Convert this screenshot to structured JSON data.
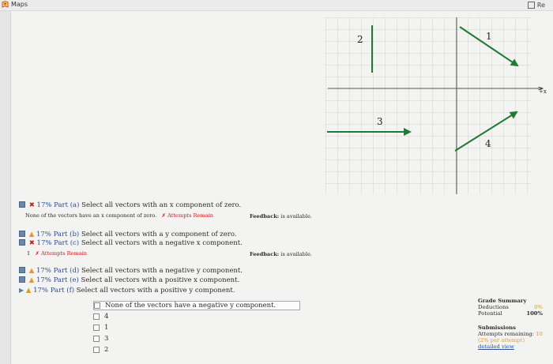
{
  "app": {
    "title": "Maps",
    "top_right_label": "Re"
  },
  "graph": {
    "axis_label": "+x",
    "vectors": [
      {
        "label": "1",
        "color": "#1f7a33"
      },
      {
        "label": "2",
        "color": "#1f7a33"
      },
      {
        "label": "3",
        "color": "#1f7a33"
      },
      {
        "label": "4",
        "color": "#1f7a33"
      }
    ]
  },
  "parts": {
    "a": {
      "pct": "17%",
      "part": "Part (a)",
      "text": "Select all vectors with an x component of zero.",
      "answer": "None of the vectors have an x component of zero.",
      "attempts": "✗ Attempts Remain",
      "feedback_label": "Feedback:",
      "feedback_text": "is available."
    },
    "b": {
      "pct": "17%",
      "part": "Part (b)",
      "text": "Select all vectors with a y component of zero."
    },
    "c": {
      "pct": "17%",
      "part": "Part (c)",
      "text": "Select all vectors with a negative x component.",
      "attempts_prefix": "1",
      "attempts": "✗ Attempts Remain",
      "feedback_label": "Feedback:",
      "feedback_text": "is available."
    },
    "d": {
      "pct": "17%",
      "part": "Part (d)",
      "text": "Select all vectors with a negative y component."
    },
    "e": {
      "pct": "17%",
      "part": "Part (e)",
      "text": "Select all vectors with a positive x component."
    },
    "f": {
      "pct": "17%",
      "part": "Part (f)",
      "text": "Select all vectors with a positive y component."
    }
  },
  "choices": [
    "None of the vectors have a negative y component.",
    "4",
    "1",
    "3",
    "2"
  ],
  "grade_summary": {
    "title": "Grade Summary",
    "deductions_label": "Deductions",
    "deductions_value": "0%",
    "potential_label": "Potential",
    "potential_value": "100%",
    "submissions_title": "Submissions",
    "attempts_label": "Attempts remaining:",
    "attempts_value": "10",
    "per_attempt": "(2% per attempt)",
    "detailed_view": "detailed view"
  }
}
